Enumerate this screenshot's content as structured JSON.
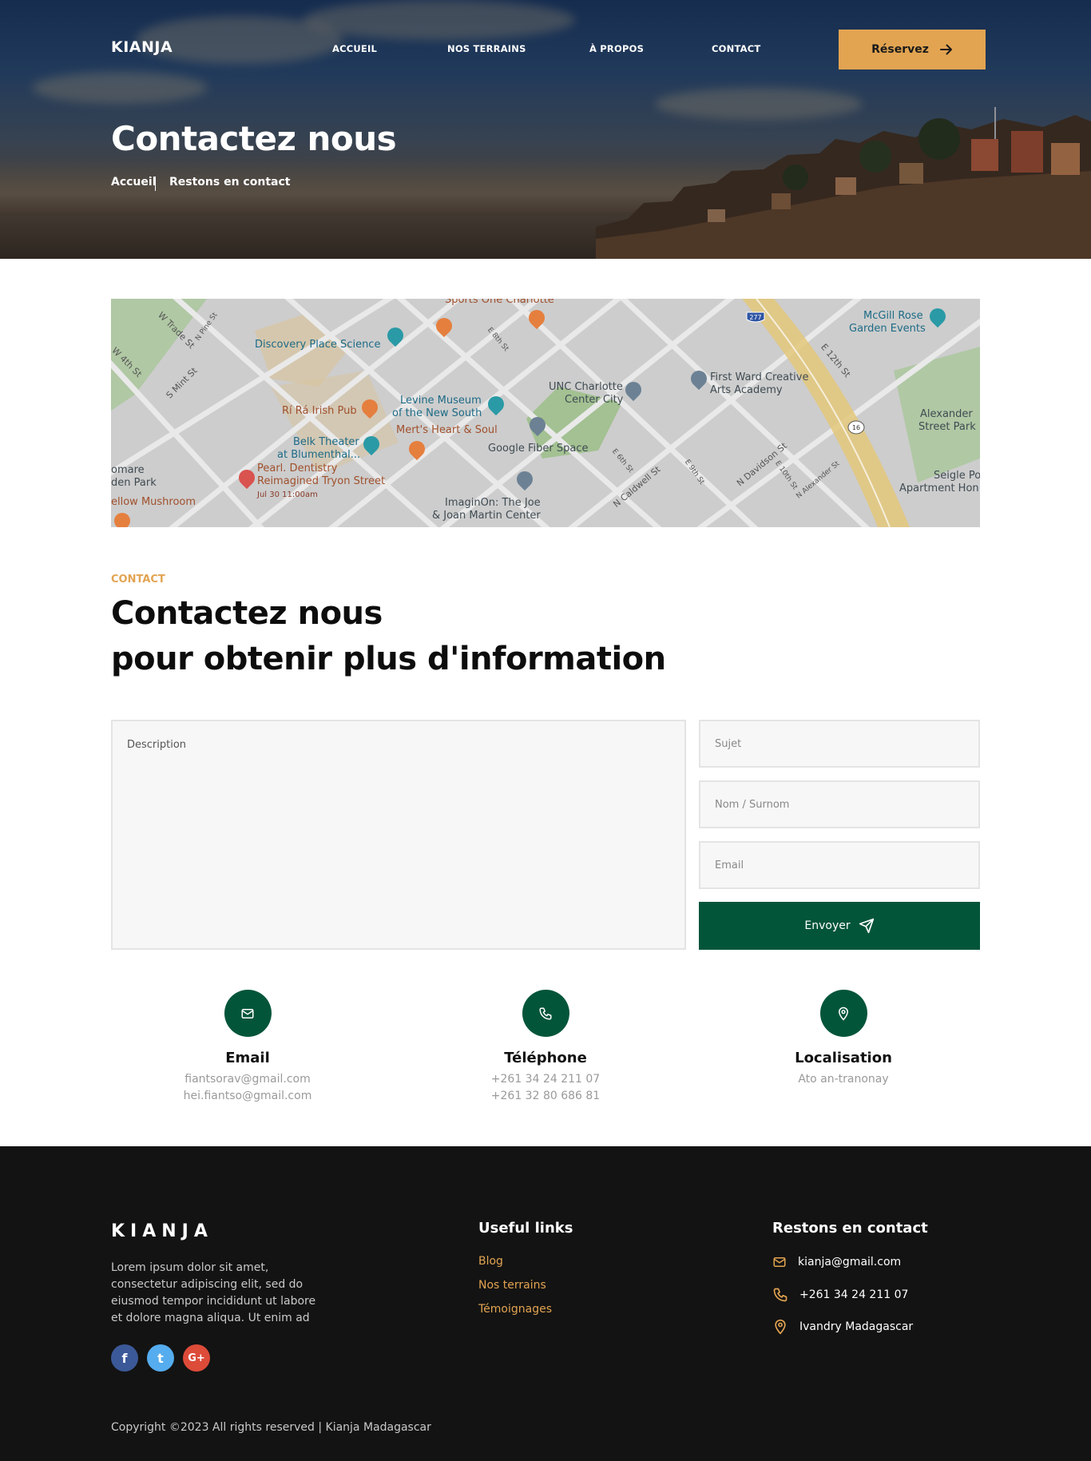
{
  "nav": {
    "logo": "KIANJA",
    "links": [
      "ACCUEIL",
      "NOS TERRAINS",
      "À PROPOS",
      "CONTACT"
    ],
    "cta_label": "Réservez",
    "cta_icon": "arrow-right-icon"
  },
  "hero": {
    "title": "Contactez nous",
    "breadcrumb": [
      "Accueil",
      "Restons en contact"
    ]
  },
  "map": {
    "places": [
      "Sports One Charlotte",
      "McGill Rose",
      "Garden Events",
      "Discovery Place Science",
      "First Ward Creative",
      "Arts Academy",
      "UNC Charlotte",
      "Center City",
      "Levine Museum",
      "of the New South",
      "Rí Rá Irish Pub",
      "Mert's Heart & Soul",
      "Belk Theater",
      "at Blumenthal...",
      "Google Fiber Space",
      "Pearl. Dentistry",
      "Reimagined Tryon Street",
      "Jul 30 11:00am",
      "ImaginOn: The Joe",
      "& Joan Martin Center",
      "Alexander",
      "Street Park",
      "Seigle Po",
      "Apartment Hon",
      "omare",
      "den Park",
      "ellow Mushroom"
    ],
    "streets": [
      "W Trade St",
      "N Pine St",
      "W 4th St",
      "S Mint St",
      "E 8th St",
      "E 12th St",
      "N Davidson St",
      "E 10th St",
      "N Alexander St",
      "N Caldwell St",
      "E 9th St",
      "E 6th St"
    ],
    "route_shields": [
      "277",
      "16"
    ]
  },
  "contact": {
    "eyebrow": "CONTACT",
    "headline_line1": "Contactez nous",
    "headline_line2": "pour obtenir plus d'information",
    "form": {
      "description_placeholder": "Description",
      "subject_placeholder": "Sujet",
      "name_placeholder": "Nom / Surnom",
      "email_placeholder": "Email",
      "send_label": "Envoyer"
    },
    "info": [
      {
        "icon": "mail-icon",
        "title": "Email",
        "lines": [
          "fiantsorav@gmail.com",
          "hei.fiantso@gmail.com"
        ]
      },
      {
        "icon": "phone-icon",
        "title": "Téléphone",
        "lines": [
          "+261 34 24 211 07",
          "+261 32 80 686 81"
        ]
      },
      {
        "icon": "location-icon",
        "title": "Localisation",
        "lines": [
          "Ato an-tranonay"
        ]
      }
    ]
  },
  "footer": {
    "logo": "KIANJA",
    "about": "Lorem ipsum dolor sit amet, consectetur adipiscing elit, sed do eiusmod tempor incididunt ut labore et dolore magna aliqua. Ut enim ad",
    "social": [
      {
        "icon": "facebook-icon",
        "glyph": "f",
        "color": "#3b5998"
      },
      {
        "icon": "twitter-icon",
        "glyph": "t",
        "color": "#55acee"
      },
      {
        "icon": "google-plus-icon",
        "glyph": "G+",
        "color": "#dd4b39"
      }
    ],
    "links_title": "Useful links",
    "links": [
      "Blog",
      "Nos terrains",
      "Témoignages"
    ],
    "contact_title": "Restons en contact",
    "contact_items": [
      {
        "icon": "mail-icon",
        "text": "kianja@gmail.com"
      },
      {
        "icon": "phone-icon",
        "text": "+261 34 24 211 07"
      },
      {
        "icon": "location-icon",
        "text": "Ivandry Madagascar"
      }
    ],
    "copyright": "Copyright ©2023 All rights reserved | Kianja Madagascar"
  },
  "colors": {
    "accent": "#e2a451",
    "brand_green": "#03553a",
    "footer_bg": "#131313"
  }
}
